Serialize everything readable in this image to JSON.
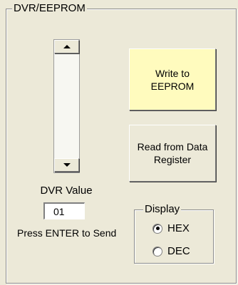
{
  "group": {
    "title": "DVR/EEPROM"
  },
  "scrollbar": {
    "up_icon": "arrow-up",
    "down_icon": "arrow-down"
  },
  "buttons": {
    "write": {
      "line1": "Write to",
      "line2": "EEPROM",
      "bg": "#FFFBBE"
    },
    "read": {
      "line1": "Read from Data",
      "line2": "Register"
    }
  },
  "dvr": {
    "label": "DVR Value",
    "value": "01",
    "hint": "Press ENTER to Send"
  },
  "display": {
    "title": "Display",
    "options": [
      {
        "label": "HEX",
        "selected": true
      },
      {
        "label": "DEC",
        "selected": false
      }
    ]
  }
}
